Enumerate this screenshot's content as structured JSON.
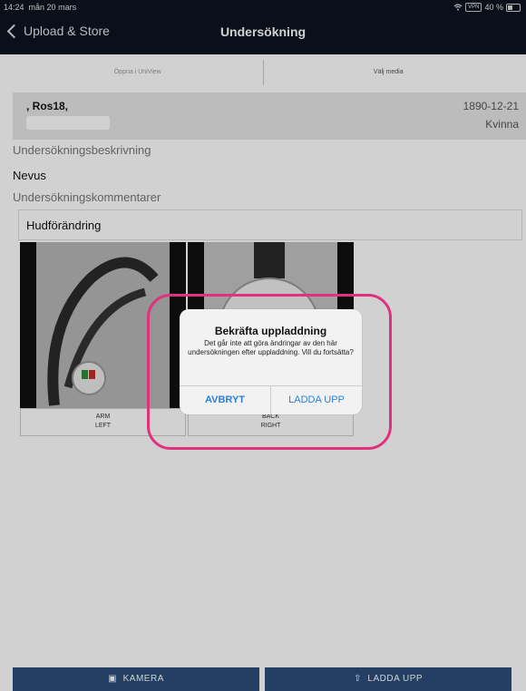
{
  "status_bar": {
    "time": "14:24",
    "date": "mån 20 mars",
    "vpn": "VPN",
    "battery": "40 %"
  },
  "nav": {
    "back_label": "Upload & Store",
    "title": "Undersökning"
  },
  "segments": [
    "Öppna i UniView",
    "Välj media"
  ],
  "patient": {
    "name": ", Ros18,",
    "birthdate": "1890-12-21",
    "sex": "Kvinna"
  },
  "exam": {
    "description_label": "Undersökningsbeskrivning",
    "description": "Nevus",
    "comments_label": "Undersökningskommentarer",
    "comment": "Hudförändring"
  },
  "images": [
    {
      "site": "ARM",
      "side": "LEFT"
    },
    {
      "site": "BACK",
      "side": "RIGHT"
    }
  ],
  "bottom": {
    "camera_label": "KAMERA",
    "upload_label": "LADDA UPP"
  },
  "dialog": {
    "title": "Bekräfta uppladdning",
    "message": "Det går inte att göra ändringar av den här undersökningen efter uppladdning. Vill du fortsätta?",
    "cancel": "AVBRYT",
    "confirm": "LADDA UPP"
  },
  "colors": {
    "nav_bg": "#0e1320",
    "accent": "#2d7fd6",
    "highlight": "#e0317f",
    "bottom_button": "#2b4d7a"
  }
}
